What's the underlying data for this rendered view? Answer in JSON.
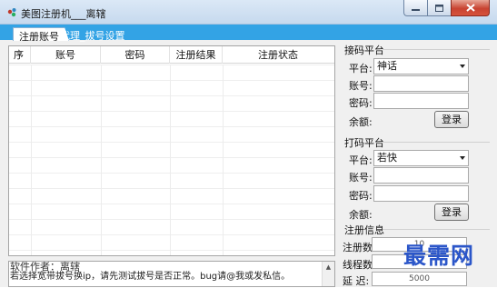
{
  "window": {
    "title": "美图注册机___离辖",
    "icon": "app-icon",
    "buttons": [
      "minimize-icon",
      "maximize-icon",
      "close-icon"
    ]
  },
  "tabs": [
    {
      "label": "注册账号",
      "active": true
    },
    {
      "label": "代理_拔号设置",
      "active": false
    }
  ],
  "grid": {
    "columns": [
      "序",
      "账号",
      "密码",
      "注册结果",
      "注册状态"
    ],
    "rows": []
  },
  "log": {
    "lines": [
      "软件作者：离辖",
      "若选择宽带拔号换ip，请先测试拔号是否正常。bug请@我或发私信。"
    ]
  },
  "jiema": {
    "title": "接码平台",
    "platform_label": "平台:",
    "platform_value": "神话",
    "account_label": "账号:",
    "account_value": "",
    "password_label": "密码:",
    "password_value": "",
    "balance_label": "余额:",
    "login_label": "登录"
  },
  "dama": {
    "title": "打码平台",
    "platform_label": "平台:",
    "platform_value": "若快",
    "account_label": "账号:",
    "account_value": "",
    "password_label": "密码:",
    "password_value": "",
    "balance_label": "余额:",
    "login_label": "登录"
  },
  "register_info": {
    "title": "注册信息",
    "count_label": "注册数:",
    "count_value": "10",
    "threads_label": "线程数:",
    "threads_value": "",
    "delay_label": "延  迟:",
    "delay_value": "5000"
  },
  "watermark": "最需网",
  "colors": {
    "tab_strip": "#33a3e5",
    "watermark": "#2b56c9"
  }
}
